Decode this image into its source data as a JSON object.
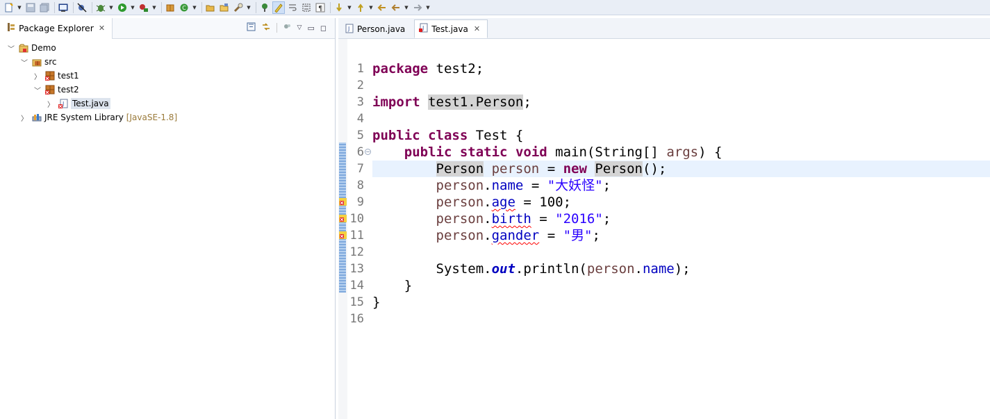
{
  "toolbar": {
    "buttons": [
      {
        "name": "new-icon",
        "drop": true
      },
      {
        "name": "save-icon"
      },
      {
        "name": "save-all-icon"
      },
      {
        "sep": true
      },
      {
        "name": "terminal-icon"
      },
      {
        "sep": true
      },
      {
        "name": "skip-breakpoints-icon"
      },
      {
        "sep": true
      },
      {
        "name": "debug-icon",
        "drop": true
      },
      {
        "name": "run-icon",
        "drop": true
      },
      {
        "name": "external-tools-icon",
        "drop": true
      },
      {
        "sep": true
      },
      {
        "name": "new-package-icon"
      },
      {
        "name": "new-class-icon",
        "drop": true
      },
      {
        "sep": true
      },
      {
        "name": "open-type-icon"
      },
      {
        "name": "open-task-icon"
      },
      {
        "name": "search-icon",
        "drop": true
      },
      {
        "sep": true
      },
      {
        "name": "toggle-breadcrumb-icon"
      },
      {
        "name": "mark-occurrences-icon",
        "active": true
      },
      {
        "name": "word-wrap-icon"
      },
      {
        "name": "block-selection-icon"
      },
      {
        "name": "show-whitespace-icon"
      },
      {
        "sep": true
      },
      {
        "name": "next-annotation-icon",
        "drop": true
      },
      {
        "name": "previous-annotation-icon",
        "drop": true
      },
      {
        "name": "last-edit-location-icon"
      },
      {
        "name": "back-icon",
        "drop": true
      },
      {
        "name": "forward-icon",
        "drop": true
      }
    ]
  },
  "package_explorer": {
    "title": "Package Explorer",
    "tree": [
      {
        "label": "Demo",
        "level": 0,
        "twisty": "open",
        "icon": "project"
      },
      {
        "label": "src",
        "level": 1,
        "twisty": "open",
        "icon": "source-folder"
      },
      {
        "label": "test1",
        "level": 2,
        "twisty": "closed",
        "icon": "package-error"
      },
      {
        "label": "test2",
        "level": 2,
        "twisty": "open",
        "icon": "package-error"
      },
      {
        "label": "Test.java",
        "level": 3,
        "twisty": "closed",
        "icon": "java-file-error",
        "selected": true
      },
      {
        "label": "JRE System Library",
        "decoration": "[JavaSE-1.8]",
        "level": 1,
        "twisty": "closed",
        "icon": "library"
      }
    ]
  },
  "editor": {
    "tabs": [
      {
        "label": "Person.java",
        "active": false
      },
      {
        "label": "Test.java",
        "active": true
      }
    ],
    "current_line": 7,
    "line_numbers": [
      "1",
      "2",
      "3",
      "4",
      "5",
      "6",
      "7",
      "8",
      "9",
      "10",
      "11",
      "12",
      "13",
      "14",
      "15",
      "16"
    ],
    "error_lines": [
      9,
      10,
      11
    ],
    "lines": [
      [
        {
          "t": "package",
          "c": "kw"
        },
        {
          "t": " test2;"
        }
      ],
      [],
      [
        {
          "t": "import",
          "c": "kw"
        },
        {
          "t": " "
        },
        {
          "t": "test1.Person",
          "c": "occ"
        },
        {
          "t": ";"
        }
      ],
      [],
      [
        {
          "t": "public",
          "c": "kw"
        },
        {
          "t": " "
        },
        {
          "t": "class",
          "c": "kw"
        },
        {
          "t": " Test {"
        }
      ],
      [
        {
          "t": "    "
        },
        {
          "t": "public",
          "c": "kw"
        },
        {
          "t": " "
        },
        {
          "t": "static",
          "c": "kw"
        },
        {
          "t": " "
        },
        {
          "t": "void",
          "c": "kw"
        },
        {
          "t": " main(String[] "
        },
        {
          "t": "args",
          "c": "lvar"
        },
        {
          "t": ") {"
        }
      ],
      [
        {
          "t": "        "
        },
        {
          "t": "Person",
          "c": "occ"
        },
        {
          "t": " "
        },
        {
          "t": "person",
          "c": "lvar"
        },
        {
          "t": " = "
        },
        {
          "t": "new",
          "c": "kw"
        },
        {
          "t": " "
        },
        {
          "t": "Person",
          "c": "occ"
        },
        {
          "t": "();"
        }
      ],
      [
        {
          "t": "        "
        },
        {
          "t": "person",
          "c": "lvar"
        },
        {
          "t": "."
        },
        {
          "t": "name",
          "c": "fld"
        },
        {
          "t": " = "
        },
        {
          "t": "\"大妖怪\"",
          "c": "str"
        },
        {
          "t": ";"
        }
      ],
      [
        {
          "t": "        "
        },
        {
          "t": "person",
          "c": "lvar"
        },
        {
          "t": "."
        },
        {
          "t": "age",
          "c": "fld err"
        },
        {
          "t": " = 100;"
        }
      ],
      [
        {
          "t": "        "
        },
        {
          "t": "person",
          "c": "lvar"
        },
        {
          "t": "."
        },
        {
          "t": "birth",
          "c": "fld err"
        },
        {
          "t": " = "
        },
        {
          "t": "\"2016\"",
          "c": "str"
        },
        {
          "t": ";"
        }
      ],
      [
        {
          "t": "        "
        },
        {
          "t": "person",
          "c": "lvar"
        },
        {
          "t": "."
        },
        {
          "t": "gander",
          "c": "fld err"
        },
        {
          "t": " = "
        },
        {
          "t": "\"男\"",
          "c": "str"
        },
        {
          "t": ";"
        }
      ],
      [],
      [
        {
          "t": "        System."
        },
        {
          "t": "out",
          "c": "sfld"
        },
        {
          "t": ".println("
        },
        {
          "t": "person",
          "c": "lvar"
        },
        {
          "t": "."
        },
        {
          "t": "name",
          "c": "fld"
        },
        {
          "t": ");"
        }
      ],
      [
        {
          "t": "    }"
        }
      ],
      [
        {
          "t": "}"
        }
      ],
      []
    ]
  }
}
